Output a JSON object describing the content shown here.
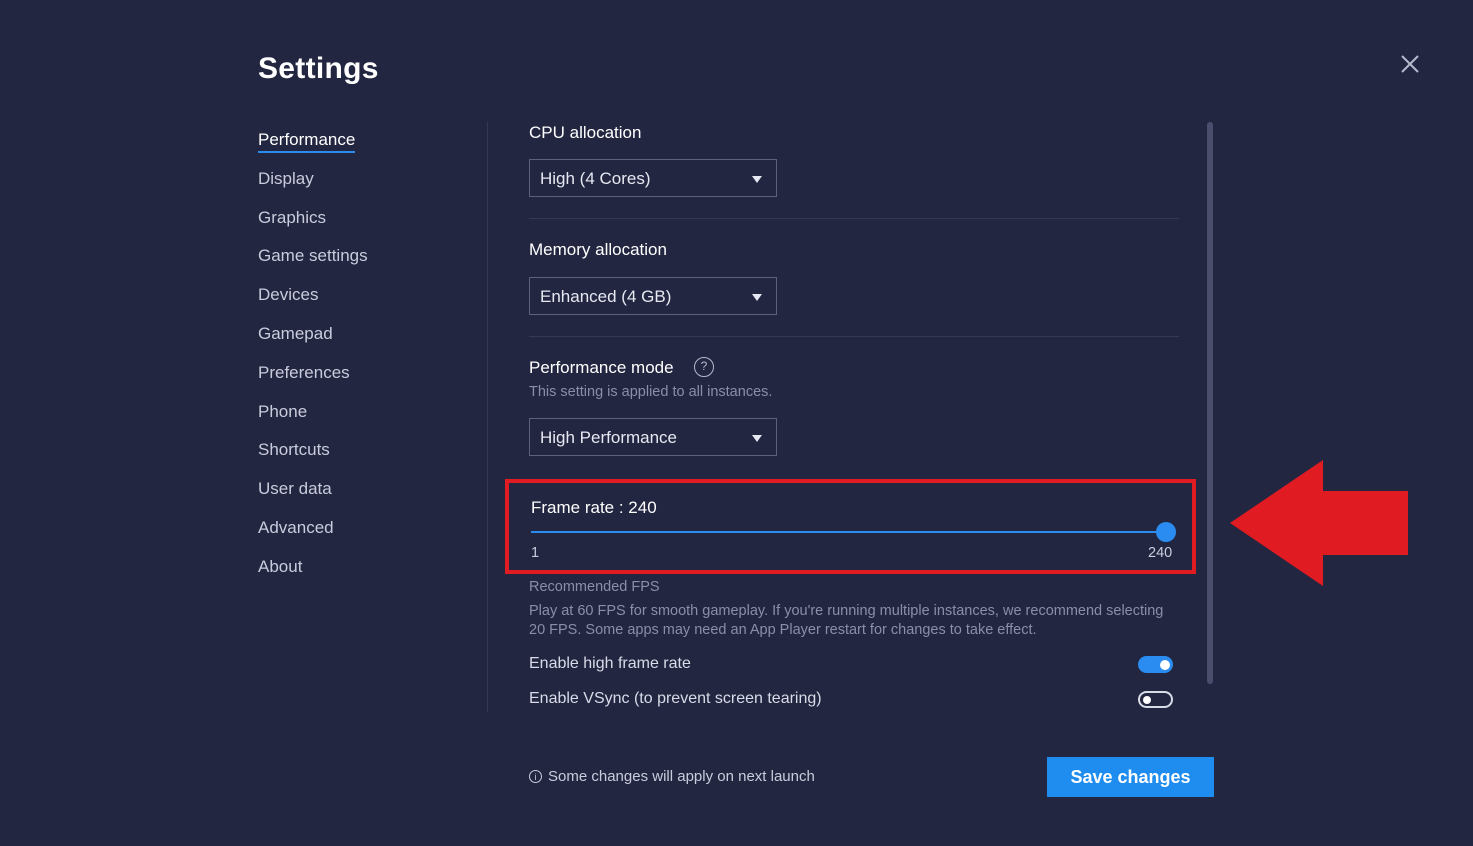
{
  "window": {
    "title": "Settings"
  },
  "sidebar": {
    "items": [
      {
        "label": "Performance",
        "active": true
      },
      {
        "label": "Display"
      },
      {
        "label": "Graphics"
      },
      {
        "label": "Game settings"
      },
      {
        "label": "Devices"
      },
      {
        "label": "Gamepad"
      },
      {
        "label": "Preferences"
      },
      {
        "label": "Phone"
      },
      {
        "label": "Shortcuts"
      },
      {
        "label": "User data"
      },
      {
        "label": "Advanced"
      },
      {
        "label": "About"
      }
    ]
  },
  "performance": {
    "cpu": {
      "label": "CPU allocation",
      "value": "High (4 Cores)"
    },
    "memory": {
      "label": "Memory allocation",
      "value": "Enhanced (4 GB)"
    },
    "mode": {
      "label": "Performance mode",
      "help": "?",
      "note": "This setting is applied to all instances.",
      "value": "High Performance"
    },
    "frame_rate": {
      "label": "Frame rate : 240",
      "value": 240,
      "min": "1",
      "max": "240"
    },
    "recommended": {
      "title": "Recommended FPS",
      "text": "Play at 60 FPS for smooth gameplay. If you're running multiple instances, we recommend selecting 20 FPS. Some apps may need an App Player restart for changes to take effect."
    },
    "toggles": [
      {
        "label": "Enable high frame rate",
        "on": true
      },
      {
        "label": "Enable VSync (to prevent screen tearing)",
        "on": false
      }
    ]
  },
  "footer": {
    "note": "Some changes will apply on next launch",
    "info_icon": "i",
    "save_label": "Save changes"
  },
  "colors": {
    "accent": "#1f8cf0",
    "background": "#232640",
    "highlight": "#e01b22"
  },
  "icons": {
    "close": "close-icon",
    "help": "help-icon",
    "info": "info-icon",
    "dropdown": "caret-down-icon",
    "annotation": "red-arrow-icon"
  }
}
